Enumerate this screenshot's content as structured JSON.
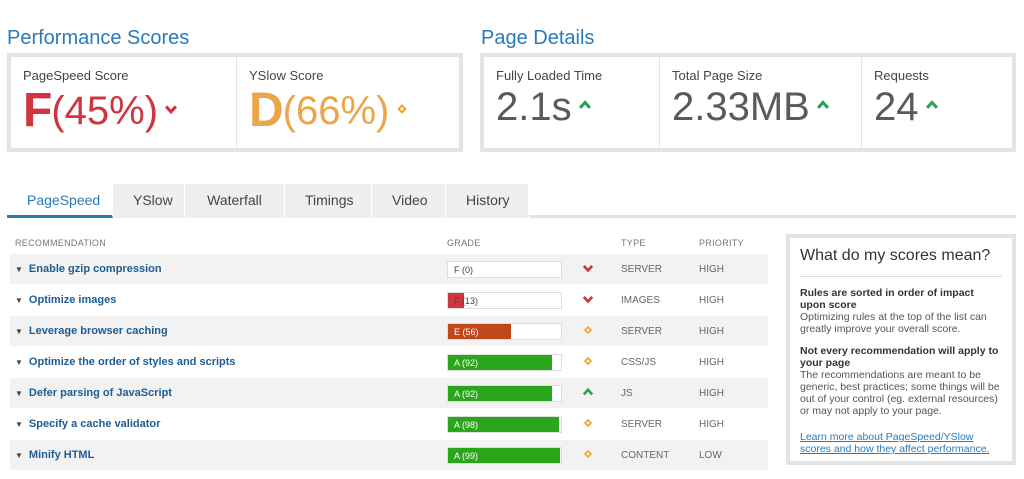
{
  "performance": {
    "title": "Performance Scores",
    "pagespeed": {
      "label": "PageSpeed Score",
      "grade": "F",
      "percent": "(45%)",
      "trend": "down"
    },
    "yslow": {
      "label": "YSlow Score",
      "grade": "D",
      "percent": "(66%)",
      "trend": "neutral"
    }
  },
  "details": {
    "title": "Page Details",
    "loaded": {
      "label": "Fully Loaded Time",
      "value": "2.1s",
      "trend": "up"
    },
    "size": {
      "label": "Total Page Size",
      "value": "2.33MB",
      "trend": "up"
    },
    "requests": {
      "label": "Requests",
      "value": "24",
      "trend": "up"
    }
  },
  "tabs": [
    {
      "label": "PageSpeed",
      "active": true
    },
    {
      "label": "YSlow"
    },
    {
      "label": "Waterfall"
    },
    {
      "label": "Timings"
    },
    {
      "label": "Video"
    },
    {
      "label": "History"
    }
  ],
  "table": {
    "headers": {
      "recommendation": "RECOMMENDATION",
      "grade": "GRADE",
      "type": "TYPE",
      "priority": "PRIORITY"
    },
    "rows": [
      {
        "name": "Enable gzip compression",
        "grade": "F (0)",
        "score": 0,
        "trend": "down",
        "type": "SERVER",
        "priority": "HIGH"
      },
      {
        "name": "Optimize images",
        "grade": "F (13)",
        "score": 13,
        "trend": "down",
        "type": "IMAGES",
        "priority": "HIGH"
      },
      {
        "name": "Leverage browser caching",
        "grade": "E (56)",
        "score": 56,
        "trend": "neutral",
        "type": "SERVER",
        "priority": "HIGH"
      },
      {
        "name": "Optimize the order of styles and scripts",
        "grade": "A (92)",
        "score": 92,
        "trend": "neutral",
        "type": "CSS/JS",
        "priority": "HIGH"
      },
      {
        "name": "Defer parsing of JavaScript",
        "grade": "A (92)",
        "score": 92,
        "trend": "up",
        "type": "JS",
        "priority": "HIGH"
      },
      {
        "name": "Specify a cache validator",
        "grade": "A (98)",
        "score": 98,
        "trend": "neutral",
        "type": "SERVER",
        "priority": "HIGH"
      },
      {
        "name": "Minify HTML",
        "grade": "A (99)",
        "score": 99,
        "trend": "neutral",
        "type": "CONTENT",
        "priority": "LOW"
      }
    ]
  },
  "info": {
    "title": "What do my scores mean?",
    "h1": "Rules are sorted in order of impact upon score",
    "p1": "Optimizing rules at the top of the list can greatly improve your overall score.",
    "h2": "Not every recommendation will apply to your page",
    "p2": "The recommendations are meant to be generic, best practices; some things will be out of your control (eg. external resources) or may not apply to your page.",
    "link": "Learn more about PageSpeed/YSlow scores and how they affect performance."
  },
  "colors": {
    "accent": "#2a7ab8",
    "grade_f": "#d0343e",
    "grade_d": "#eba64a",
    "grade_e": "#c0471a",
    "grade_a": "#2aa61b",
    "trend_up": "#2aa05a",
    "trend_down": "#d0343e",
    "trend_neutral": "#f0a030"
  }
}
